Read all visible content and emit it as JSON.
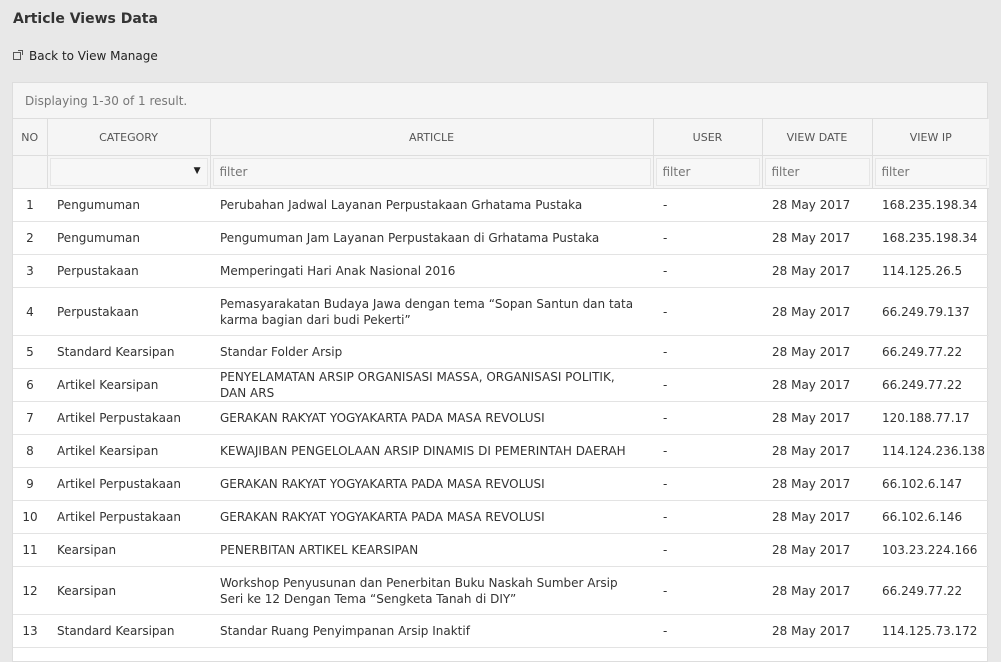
{
  "page": {
    "title": "Article Views Data"
  },
  "back_link": {
    "label": "Back to View Manage",
    "icon": "external-link-icon"
  },
  "summary": "Displaying 1-30 of 1 result.",
  "table": {
    "headers": [
      "NO",
      "CATEGORY",
      "ARTICLE",
      "USER",
      "VIEW DATE",
      "VIEW IP"
    ],
    "filters": {
      "category": "",
      "article_placeholder": "filter",
      "user_placeholder": "filter",
      "date_placeholder": "filter",
      "ip_placeholder": "filter"
    },
    "rows": [
      {
        "no": "1",
        "category": "Pengumuman",
        "article": "Perubahan Jadwal Layanan Perpustakaan Grhatama Pustaka",
        "user": "-",
        "date": "28 May 2017",
        "ip": "168.235.198.34"
      },
      {
        "no": "2",
        "category": "Pengumuman",
        "article": "Pengumuman Jam Layanan Perpustakaan di Grhatama Pustaka",
        "user": "-",
        "date": "28 May 2017",
        "ip": "168.235.198.34"
      },
      {
        "no": "3",
        "category": "Perpustakaan",
        "article": "Memperingati Hari Anak Nasional 2016",
        "user": "-",
        "date": "28 May 2017",
        "ip": "114.125.26.5"
      },
      {
        "no": "4",
        "category": "Perpustakaan",
        "article": "Pemasyarakatan Budaya Jawa dengan tema “Sopan Santun dan tata karma bagian dari budi Pekerti”",
        "user": "-",
        "date": "28 May 2017",
        "ip": "66.249.79.137"
      },
      {
        "no": "5",
        "category": "Standard Kearsipan",
        "article": "Standar Folder Arsip",
        "user": "-",
        "date": "28 May 2017",
        "ip": "66.249.77.22"
      },
      {
        "no": "6",
        "category": "Artikel Kearsipan",
        "article": "PENYELAMATAN ARSIP ORGANISASI MASSA, ORGANISASI POLITIK, DAN ARS",
        "user": "-",
        "date": "28 May 2017",
        "ip": "66.249.77.22"
      },
      {
        "no": "7",
        "category": "Artikel Perpustakaan",
        "article": "GERAKAN RAKYAT YOGYAKARTA PADA MASA REVOLUSI",
        "user": "-",
        "date": "28 May 2017",
        "ip": "120.188.77.17"
      },
      {
        "no": "8",
        "category": "Artikel Kearsipan",
        "article": "KEWAJIBAN PENGELOLAAN ARSIP DINAMIS DI PEMERINTAH DAERAH",
        "user": "-",
        "date": "28 May 2017",
        "ip": "114.124.236.138"
      },
      {
        "no": "9",
        "category": "Artikel Perpustakaan",
        "article": "GERAKAN RAKYAT YOGYAKARTA PADA MASA REVOLUSI",
        "user": "-",
        "date": "28 May 2017",
        "ip": "66.102.6.147"
      },
      {
        "no": "10",
        "category": "Artikel Perpustakaan",
        "article": "GERAKAN RAKYAT YOGYAKARTA PADA MASA REVOLUSI",
        "user": "-",
        "date": "28 May 2017",
        "ip": "66.102.6.146"
      },
      {
        "no": "11",
        "category": "Kearsipan",
        "article": "PENERBITAN ARTIKEL KEARSIPAN",
        "user": "-",
        "date": "28 May 2017",
        "ip": "103.23.224.166"
      },
      {
        "no": "12",
        "category": "Kearsipan",
        "article": "Workshop Penyusunan dan Penerbitan Buku Naskah Sumber Arsip Seri ke 12 Dengan Tema “Sengketa Tanah di DIY”",
        "user": "-",
        "date": "28 May 2017",
        "ip": "66.249.77.22"
      },
      {
        "no": "13",
        "category": "Standard Kearsipan",
        "article": "Standar Ruang Penyimpanan Arsip Inaktif",
        "user": "-",
        "date": "28 May 2017",
        "ip": "114.125.73.172"
      }
    ]
  }
}
